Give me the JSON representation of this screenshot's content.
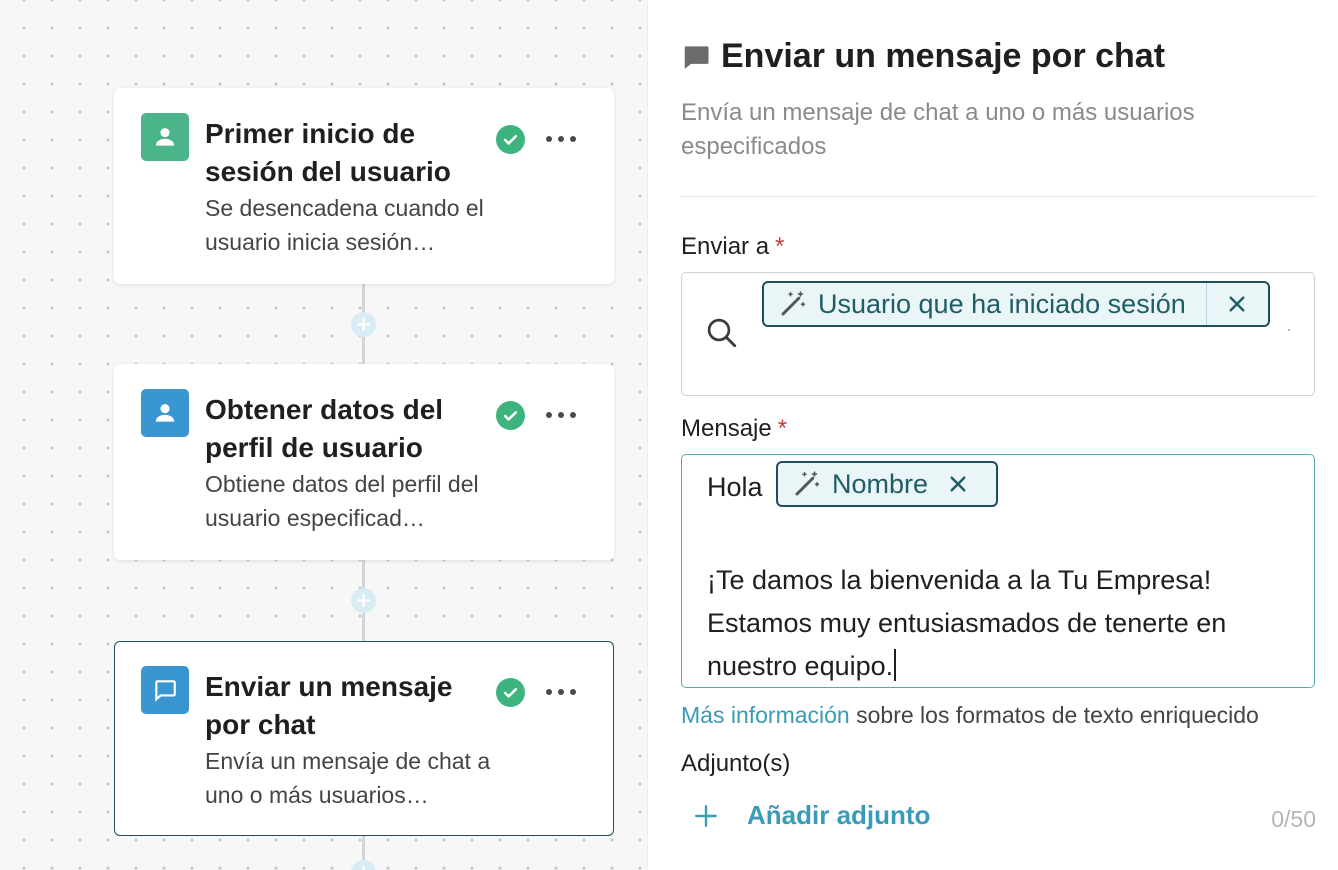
{
  "colors": {
    "trigger_icon_bg": "#4bb58a",
    "step_icon_bg": "#3a96d1",
    "chat_icon_bg": "#3a96d1",
    "check_green": "#3db37e",
    "accent_link": "#3a9bb8",
    "chip_border": "#1f4e5c",
    "required": "#c23a3a"
  },
  "workflow": {
    "steps": [
      {
        "icon": "user-icon",
        "title": "Primer inicio de sesión del usuario",
        "description": "Se desencadena cuando el usuario inicia sesión…",
        "status": "check-icon",
        "selected": false
      },
      {
        "icon": "user-icon",
        "title": "Obtener datos del perfil de usuario",
        "description": "Obtiene datos del perfil del usuario especificad…",
        "status": "check-icon",
        "selected": false
      },
      {
        "icon": "chat-icon",
        "title": "Enviar un mensaje por chat",
        "description": "Envía un mensaje de chat a uno o más usuarios…",
        "status": "check-icon",
        "selected": true
      }
    ]
  },
  "panel": {
    "header_icon": "chat-bubble-icon",
    "title": "Enviar un mensaje por chat",
    "subtitle": "Envía un mensaje de chat a uno o más usuarios especificados",
    "send_to": {
      "label": "Enviar a",
      "required_mark": "*",
      "search_icon": "search-icon",
      "chip_icon": "magic-wand-icon",
      "chip_label": "Usuario que ha iniciado sesión"
    },
    "message": {
      "label": "Mensaje",
      "required_mark": "*",
      "greeting": "Hola",
      "chip_icon": "magic-wand-icon",
      "chip_label": "Nombre",
      "line1": "¡Te damos la bienvenida a la Tu Empresa!",
      "line2": "Estamos muy entusiasmados de tenerte en nuestro equipo."
    },
    "rich_text_help": {
      "link": "Más información",
      "text": " sobre los formatos de texto enriquecido"
    },
    "attachments": {
      "label": "Adjunto(s)",
      "add_icon": "plus-icon",
      "add_label": "Añadir adjunto",
      "count": "0/50"
    }
  }
}
